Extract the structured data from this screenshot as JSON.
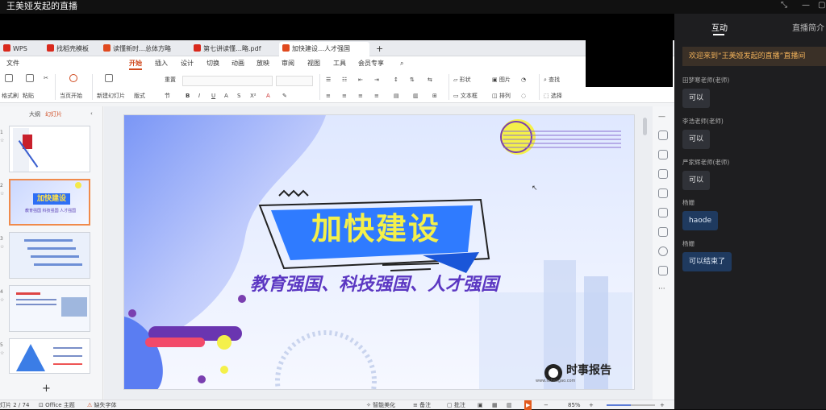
{
  "window": {
    "title": "王美娅发起的直播"
  },
  "wps": {
    "tabs": [
      {
        "label": "WPS Office",
        "color": "#d9291c"
      },
      {
        "label": "找稻壳模板",
        "color": "#d9291c"
      },
      {
        "label": "读懂新时…总体方略",
        "color": "#e04a1f"
      },
      {
        "label": "第七讲读懂…略.pdf",
        "color": "#d9291c"
      },
      {
        "label": "加快建设…人才强国",
        "color": "#e04a1f"
      }
    ],
    "new_tab": "+",
    "menu": [
      "文件",
      "开始",
      "插入",
      "设计",
      "切换",
      "动画",
      "放映",
      "审阅",
      "视图",
      "工具",
      "会员专享"
    ],
    "menu_active": "开始",
    "ribbon": {
      "format_painter": "格式刷",
      "paste": "粘贴",
      "current_start": "当页开始",
      "new_slide": "新建幻灯片",
      "layout": "版式",
      "section": "节",
      "reset": "重置",
      "shape": "形状",
      "picture": "图片",
      "textbox": "文本框",
      "arrange": "排列",
      "find": "查找",
      "select": "选择"
    },
    "left_tabs": {
      "outline": "大纲",
      "slides": "幻灯片"
    },
    "slide_numbers": [
      "1",
      "2",
      "3",
      "4",
      "5"
    ],
    "status": {
      "slide_count": "灯片 2 / 74",
      "theme": "Office 主题",
      "missing_font": "缺失字体",
      "smart_beautify": "智能美化",
      "notes": "备注",
      "comments": "批注",
      "zoom": "85%"
    }
  },
  "slide": {
    "title": "加快建设",
    "subtitle": "教育强国、科技强国、人才强国",
    "brand": "时事报告",
    "brand_url": "www.ssbaogao.com"
  },
  "thumbs": {
    "t2_title": "加快建设",
    "t2_sub": "教育强国 科技强国 人才强国"
  },
  "panel": {
    "tabs": [
      "互动",
      "直播简介"
    ],
    "welcome": "欢迎来到“王美娅发起的直播”直播间",
    "messages": [
      {
        "name": "田梦寒老师(老师)",
        "text": "可以",
        "blue": false
      },
      {
        "name": "李浩老师(老师)",
        "text": "可以",
        "blue": false
      },
      {
        "name": "严家辉老师(老师)",
        "text": "可以",
        "blue": false
      },
      {
        "name": "杨姗",
        "text": "haode",
        "blue": true
      },
      {
        "name": "杨姗",
        "text": "可以结束了",
        "blue": true
      }
    ]
  }
}
